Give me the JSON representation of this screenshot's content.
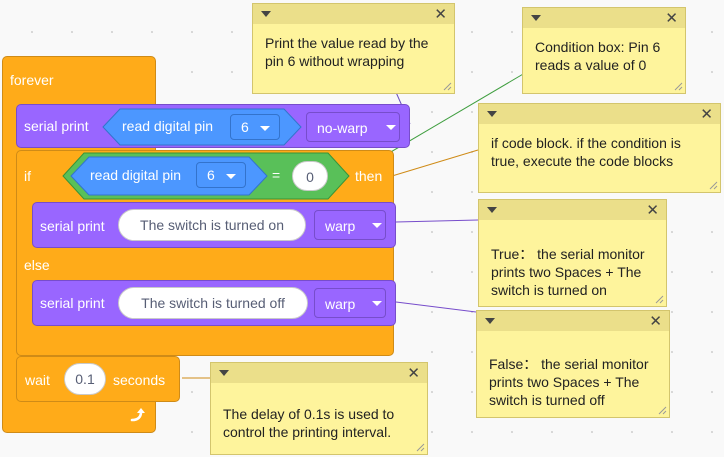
{
  "blocks": {
    "forever": "forever",
    "serial_print_1": {
      "label": "serial print",
      "reporter": "read digital pin",
      "pin": "6",
      "mode": "no-warp"
    },
    "if_block": {
      "if": "if",
      "reporter": "read digital pin",
      "pin": "6",
      "op": "=",
      "value": "0",
      "then": "then"
    },
    "serial_print_2": {
      "label": "serial print",
      "text": "The switch is turned on",
      "mode": "warp"
    },
    "else": "else",
    "serial_print_3": {
      "label": "serial print",
      "text": "The switch is turned off",
      "mode": "warp"
    },
    "wait": {
      "label": "wait",
      "value": "0.1",
      "unit": "seconds"
    }
  },
  "comments": [
    {
      "lines": [
        "Print the value read by the",
        "pin 6 without wrapping"
      ]
    },
    {
      "lines": [
        "Condition box: Pin 6",
        "reads a value of 0"
      ]
    },
    {
      "lines": [
        "if code block. if the condition is",
        "true, execute the code blocks"
      ]
    },
    {
      "lines": [
        "True： the serial monitor",
        "prints two Spaces + The",
        "switch is turned on"
      ]
    },
    {
      "lines": [
        "False： the serial monitor",
        "prints two Spaces + The",
        "switch is turned off"
      ]
    },
    {
      "lines": [
        "The delay of 0.1s is used to",
        "control the printing interval."
      ]
    }
  ],
  "colors": {
    "control": "#ffab19",
    "looks_purple": "#9966ff",
    "sensing_blue": "#4c97ff",
    "operator_green": "#59c059",
    "note_yellow": "#fef49c"
  }
}
